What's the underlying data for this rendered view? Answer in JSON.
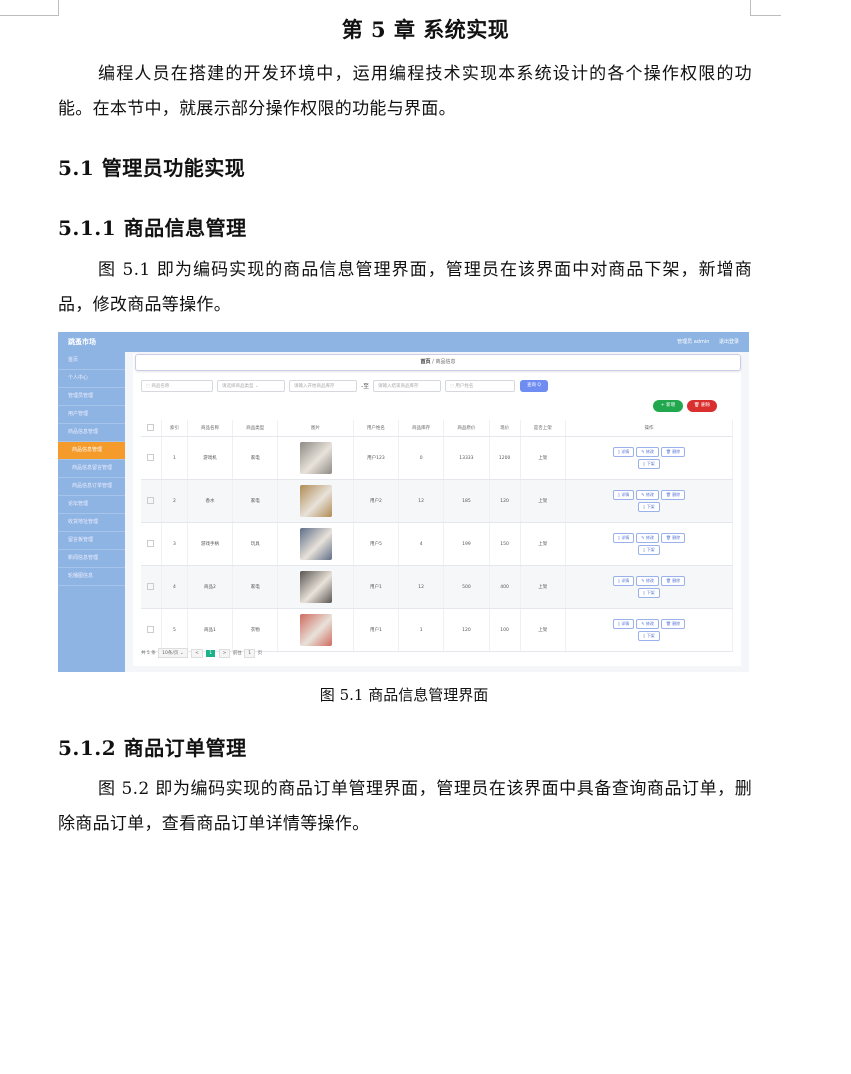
{
  "chapter_title": "第 5 章  系统实现",
  "intro": "编程人员在搭建的开发环境中，运用编程技术实现本系统设计的各个操作权限的功能。在本节中，就展示部分操作权限的功能与界面。",
  "section_5_1": "5.1  管理员功能实现",
  "section_5_1_1": "5.1.1  商品信息管理",
  "para_5_1_1": "图 5.1  即为编码实现的商品信息管理界面，管理员在该界面中对商品下架，新增商品，修改商品等操作。",
  "figure": {
    "app_title": "跳蚤市场",
    "header_user": "管理员 admin",
    "header_logout": "退出登录",
    "sidebar": [
      {
        "label": "首页",
        "type": "item"
      },
      {
        "label": "个人中心",
        "type": "item"
      },
      {
        "label": "管理员管理",
        "type": "item"
      },
      {
        "label": "用户管理",
        "type": "item"
      },
      {
        "label": "商品信息管理",
        "type": "item"
      },
      {
        "label": "商品信息管理",
        "type": "active"
      },
      {
        "label": "商品信息留言管理",
        "type": "sub"
      },
      {
        "label": "商品信息订单管理",
        "type": "sub"
      },
      {
        "label": "论坛管理",
        "type": "item"
      },
      {
        "label": "收货地址管理",
        "type": "item"
      },
      {
        "label": "留言板管理",
        "type": "item"
      },
      {
        "label": "新闻信息管理",
        "type": "item"
      },
      {
        "label": "轮播图信息",
        "type": "item"
      }
    ],
    "breadcrumb_home": "首页",
    "breadcrumb_sep": "/",
    "breadcrumb_current": "商品信息",
    "filters": {
      "name_placeholder": "商品名称",
      "type_placeholder": "请选择商品类型",
      "start_time_placeholder": "请输入开始商品库存",
      "range_sep": "-至",
      "end_time_placeholder": "请输入结束商品库存",
      "user_placeholder": "用户姓名",
      "search_label": "查询 Q"
    },
    "add_label": "+ 新增",
    "delete_label": "删除",
    "table": {
      "headers": [
        "",
        "索引",
        "商品名称",
        "商品类型",
        "图片",
        "用户姓名",
        "商品库存",
        "商品原价",
        "现价",
        "是否上架",
        "操作"
      ],
      "rows": [
        {
          "index": "1",
          "name": "游戏机",
          "type": "家电",
          "img_color": "#8d8a84",
          "user": "用户123",
          "stock": "0",
          "orig": "13333",
          "price": "1200",
          "status": "上架"
        },
        {
          "index": "2",
          "name": "香水",
          "type": "家电",
          "img_color": "#b08a53",
          "user": "用户2",
          "stock": "12",
          "orig": "185",
          "price": "120",
          "status": "上架"
        },
        {
          "index": "3",
          "name": "游戏手柄",
          "type": "玩具",
          "img_color": "#5d6d86",
          "user": "用户5",
          "stock": "4",
          "orig": "199",
          "price": "150",
          "status": "上架"
        },
        {
          "index": "4",
          "name": "商品2",
          "type": "家电",
          "img_color": "#5a5551",
          "user": "用户1",
          "stock": "12",
          "orig": "500",
          "price": "400",
          "status": "上架"
        },
        {
          "index": "5",
          "name": "商品1",
          "type": "衣物",
          "img_color": "#cf6a5e",
          "user": "用户1",
          "stock": "1",
          "orig": "120",
          "price": "100",
          "status": "上架"
        }
      ],
      "op_detail": "详情",
      "op_edit": "修改",
      "op_delete": "删除",
      "op_offshelf": "下架"
    },
    "pager": {
      "total": "共 5 条",
      "per_page": "10条/页",
      "prev": "<",
      "page": "1",
      "next": ">",
      "goto": "前往",
      "goto_page": "1",
      "page_unit": "页"
    }
  },
  "caption_5_1": "图 5.1  商品信息管理界面",
  "section_5_1_2": "5.1.2  商品订单管理",
  "para_5_1_2": "图 5.2  即为编码实现的商品订单管理界面，管理员在该界面中具备查询商品订单，删除商品订单，查看商品订单详情等操作。"
}
